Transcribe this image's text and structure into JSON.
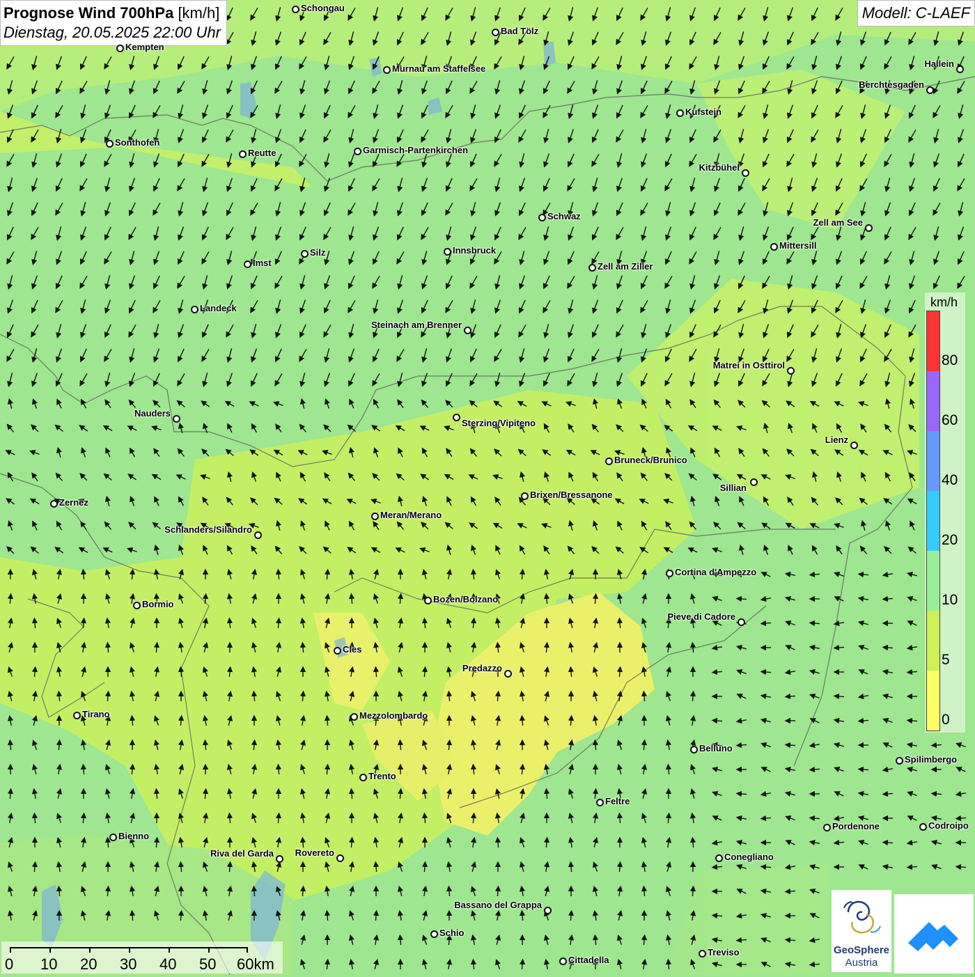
{
  "title": {
    "bold": "Prognose Wind 700hPa",
    "unit": "[km/h]",
    "datetime": "Dienstag, 20.05.2025 22:00 Uhr"
  },
  "model": "Modell: C-LAEF",
  "legend": {
    "unit": "km/h",
    "colors": [
      "#ff3333",
      "#9966ff",
      "#6699ff",
      "#33ccff",
      "#99ee99",
      "#ccf055",
      "#ffff66"
    ],
    "ticks": [
      "80",
      "60",
      "40",
      "20",
      "10",
      "5",
      "0"
    ]
  },
  "scale": {
    "labels": [
      "0",
      "10",
      "20",
      "30",
      "40",
      "50",
      "60km"
    ]
  },
  "logo": {
    "line1": "GeoSphere",
    "line2": "Austria"
  },
  "cities": [
    {
      "name": "Schongau"
    },
    {
      "name": "Bad Tölz"
    },
    {
      "name": "Kempten"
    },
    {
      "name": "Murnau am Staffelsee"
    },
    {
      "name": "Hallein"
    },
    {
      "name": "Berchtesgaden"
    },
    {
      "name": "Kufstein"
    },
    {
      "name": "Sonthofen"
    },
    {
      "name": "Reutte"
    },
    {
      "name": "Garmisch-Partenkirchen"
    },
    {
      "name": "Kitzbühel"
    },
    {
      "name": "Schwaz"
    },
    {
      "name": "Zell am See"
    },
    {
      "name": "Mittersill"
    },
    {
      "name": "Silz"
    },
    {
      "name": "Innsbruck"
    },
    {
      "name": "Imst"
    },
    {
      "name": "Zell am Ziller"
    },
    {
      "name": "Landeck"
    },
    {
      "name": "Steinach am Brenner"
    },
    {
      "name": "Matrei in Osttirol"
    },
    {
      "name": "Nauders"
    },
    {
      "name": "Sterzing/Vipiteno"
    },
    {
      "name": "Lienz"
    },
    {
      "name": "Bruneck/Brunico"
    },
    {
      "name": "Sillian"
    },
    {
      "name": "Brixen/Bressanone"
    },
    {
      "name": "Zernez"
    },
    {
      "name": "Meran/Merano"
    },
    {
      "name": "Schlanders/Silandro"
    },
    {
      "name": "Cortina d'Ampezzo"
    },
    {
      "name": "Bozen/Bolzano"
    },
    {
      "name": "Bormio"
    },
    {
      "name": "Pieve di Cadore"
    },
    {
      "name": "Cles"
    },
    {
      "name": "Predazzo"
    },
    {
      "name": "Tirano"
    },
    {
      "name": "Mezzolombardo"
    },
    {
      "name": "Belluno"
    },
    {
      "name": "Spilimbergo"
    },
    {
      "name": "Trento"
    },
    {
      "name": "Feltre"
    },
    {
      "name": "Pordenone"
    },
    {
      "name": "Codroipo"
    },
    {
      "name": "Bienno"
    },
    {
      "name": "Riva del Garda"
    },
    {
      "name": "Rovereto"
    },
    {
      "name": "Conegliano"
    },
    {
      "name": "Bassano del Grappa"
    },
    {
      "name": "Schio"
    },
    {
      "name": "Treviso"
    },
    {
      "name": "Cittadella"
    }
  ]
}
